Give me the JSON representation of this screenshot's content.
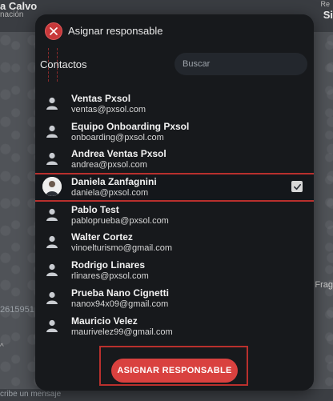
{
  "background": {
    "contact_name": "a Calvo",
    "contact_sub": "nación",
    "right_top": "Re",
    "right_name": "Si",
    "phone_fragment": "2615951",
    "side_fragment": "Frag",
    "footer_placeholder": "cribe un mensaje"
  },
  "modal": {
    "title": "Asignar responsable",
    "contacts_label": "Contactos",
    "search_placeholder": "Buscar",
    "assign_button": "ASIGNAR RESPONSABLE",
    "accent_color": "#d9413f"
  },
  "contacts": [
    {
      "name": "Ventas Pxsol",
      "email": "ventas@pxsol.com",
      "selected": false
    },
    {
      "name": "Equipo Onboarding Pxsol",
      "email": "onboarding@pxsol.com",
      "selected": false
    },
    {
      "name": "Andrea Ventas Pxsol",
      "email": "andrea@pxsol.com",
      "selected": false
    },
    {
      "name": "Daniela Zanfagnini",
      "email": "daniela@pxsol.com",
      "selected": true
    },
    {
      "name": "Pablo Test",
      "email": "pabloprueba@pxsol.com",
      "selected": false
    },
    {
      "name": "Walter Cortez",
      "email": "vinoelturismo@gmail.com",
      "selected": false
    },
    {
      "name": "Rodrigo Linares",
      "email": "rlinares@pxsol.com",
      "selected": false
    },
    {
      "name": "Prueba Nano Cignetti",
      "email": "nanox94x09@gmail.com",
      "selected": false
    },
    {
      "name": "Mauricio Velez",
      "email": "maurivelez99@gmail.com",
      "selected": false
    }
  ]
}
